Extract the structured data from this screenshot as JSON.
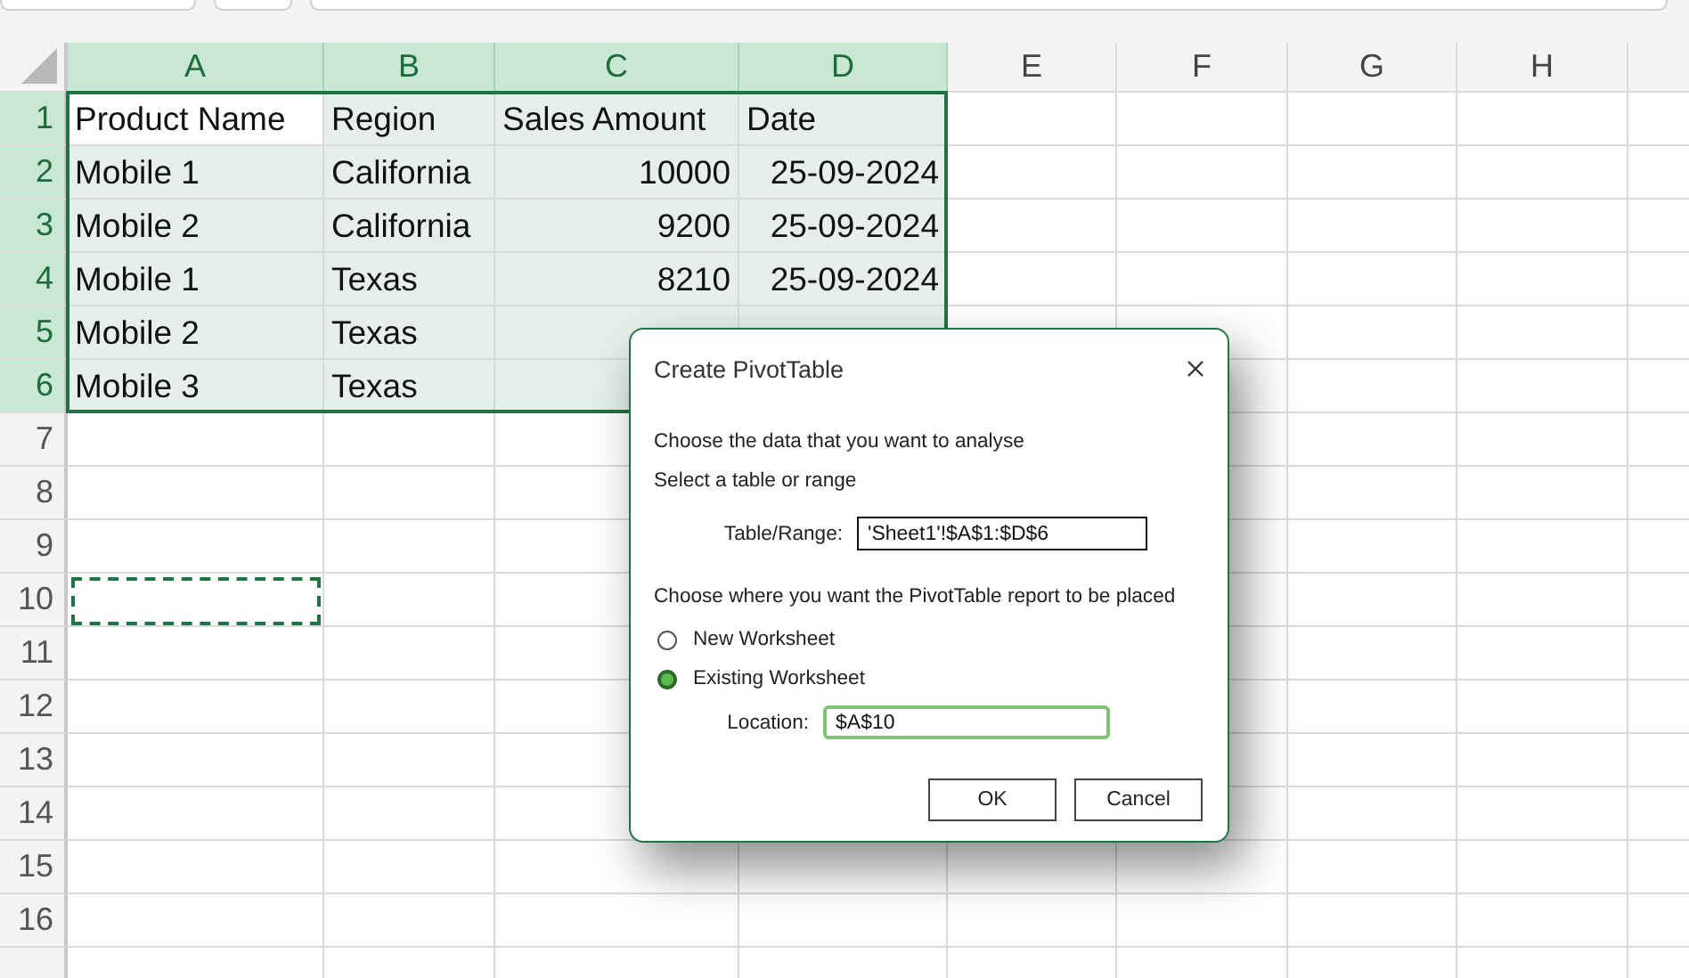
{
  "columns": [
    {
      "label": "A",
      "selected": true
    },
    {
      "label": "B",
      "selected": true
    },
    {
      "label": "C",
      "selected": true
    },
    {
      "label": "D",
      "selected": true
    },
    {
      "label": "E",
      "selected": false
    },
    {
      "label": "F",
      "selected": false
    },
    {
      "label": "G",
      "selected": false
    },
    {
      "label": "H",
      "selected": false
    }
  ],
  "rows": [
    {
      "number": "1",
      "selected": true,
      "marquee": false,
      "cells": [
        {
          "text": "Product Name",
          "kind": "text",
          "active": true
        },
        {
          "text": "Region",
          "kind": "text",
          "active": false
        },
        {
          "text": "Sales Amount",
          "kind": "text",
          "active": false
        },
        {
          "text": "Date",
          "kind": "text",
          "active": false
        }
      ]
    },
    {
      "number": "2",
      "selected": true,
      "marquee": false,
      "cells": [
        {
          "text": "Mobile 1",
          "kind": "text",
          "active": false
        },
        {
          "text": "California",
          "kind": "text",
          "active": false
        },
        {
          "text": "10000",
          "kind": "number",
          "active": false
        },
        {
          "text": "25-09-2024",
          "kind": "number",
          "active": false
        }
      ]
    },
    {
      "number": "3",
      "selected": true,
      "marquee": false,
      "cells": [
        {
          "text": "Mobile 2",
          "kind": "text",
          "active": false
        },
        {
          "text": "California",
          "kind": "text",
          "active": false
        },
        {
          "text": "9200",
          "kind": "number",
          "active": false
        },
        {
          "text": "25-09-2024",
          "kind": "number",
          "active": false
        }
      ]
    },
    {
      "number": "4",
      "selected": true,
      "marquee": false,
      "cells": [
        {
          "text": "Mobile 1",
          "kind": "text",
          "active": false
        },
        {
          "text": "Texas",
          "kind": "text",
          "active": false
        },
        {
          "text": "8210",
          "kind": "number",
          "active": false
        },
        {
          "text": "25-09-2024",
          "kind": "number",
          "active": false
        }
      ]
    },
    {
      "number": "5",
      "selected": true,
      "marquee": false,
      "cells": [
        {
          "text": "Mobile 2",
          "kind": "text",
          "active": false
        },
        {
          "text": "Texas",
          "kind": "text",
          "active": false
        }
      ]
    },
    {
      "number": "6",
      "selected": true,
      "marquee": false,
      "cells": [
        {
          "text": "Mobile 3",
          "kind": "text",
          "active": false
        },
        {
          "text": "Texas",
          "kind": "text",
          "active": false
        }
      ]
    },
    {
      "number": "7",
      "selected": false,
      "marquee": false
    },
    {
      "number": "8",
      "selected": false,
      "marquee": false
    },
    {
      "number": "9",
      "selected": false,
      "marquee": false
    },
    {
      "number": "10",
      "selected": false,
      "marquee": true
    },
    {
      "number": "11",
      "selected": false,
      "marquee": false
    },
    {
      "number": "12",
      "selected": false,
      "marquee": false
    },
    {
      "number": "13",
      "selected": false,
      "marquee": false
    },
    {
      "number": "14",
      "selected": false,
      "marquee": false
    },
    {
      "number": "15",
      "selected": false,
      "marquee": false
    },
    {
      "number": "16",
      "selected": false,
      "marquee": false
    }
  ],
  "dialog": {
    "title": "Create PivotTable",
    "data_heading": "Choose the data that you want to analyse",
    "source_option": "Select a table or range",
    "range_field": {
      "label": "Table/Range:",
      "value": "'Sheet1'!$A$1:$D$6",
      "focused": false
    },
    "placement_heading": "Choose where you want the PivotTable report to be placed",
    "placement_options": [
      {
        "label": "New Worksheet",
        "selected": false
      },
      {
        "label": "Existing Worksheet",
        "selected": true
      }
    ],
    "location_field": {
      "label": "Location:",
      "value": "$A$10",
      "focused": true
    },
    "buttons": [
      "OK",
      "Cancel"
    ]
  }
}
